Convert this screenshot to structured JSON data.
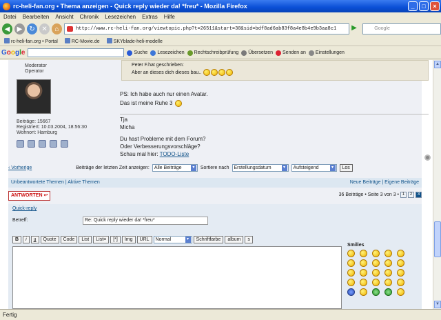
{
  "window": {
    "title": "rc-heli-fan.org • Thema anzeigen - Quick reply wieder da! *freu* - Mozilla Firefox"
  },
  "menu": [
    "Datei",
    "Bearbeiten",
    "Ansicht",
    "Chronik",
    "Lesezeichen",
    "Extras",
    "Hilfe"
  ],
  "nav": {
    "url": "http://www.rc-heli-fan.org/viewtopic.php?t=26511&start=30&sid=bdf8ad6ab83f8a4e8b4e9b3aa8c1",
    "search_placeholder": "Google"
  },
  "bookmarks": [
    "rc-heli-fan.org • Portal",
    "RC-Movie.de",
    "SKYblade-heli-modelle"
  ],
  "google_toolbar": {
    "logo_letters": [
      "G",
      "o",
      "o",
      "g",
      "l",
      "e"
    ],
    "items": [
      "Suche",
      "Lesezeichen",
      "Rechtschreibprüfung",
      "Übersetzen",
      "Senden an",
      "Einstellungen"
    ]
  },
  "post": {
    "rank": [
      "Moderator",
      "Operator"
    ],
    "stats": [
      "Beiträge: 15667",
      "Registriert: 10.03.2004, 18:56:30",
      "Wohnort: Hamburg"
    ],
    "quote_author": "Peter F.hat geschrieben:",
    "quote_text": "Aber an dieses dich dieses bau..",
    "line1": "PS: Ich habe auch nur einen Avatar.",
    "line2": "Das ist meine Ruhe 3 ",
    "greet1": "Tja",
    "greet2": "Micha",
    "sig1": "Du hast Probleme mit dem Forum?",
    "sig2": "Oder Verbesserungsvorschläge?",
    "sig3_prefix": "Schau mal hier: ",
    "sig3_link": "TODO-Liste"
  },
  "sortbar": {
    "back": "‹ Vorherige",
    "label1": "Beiträge der letzten Zeit anzeigen:",
    "sel1": "Alle Beiträge",
    "label2": "Sortiere nach",
    "sel2": "Erstellungsdatum",
    "sel3": "Aufsteigend",
    "go": "Los"
  },
  "linkbar": {
    "left": "Unbeantwortete Themen | Aktive Themen",
    "right": "Neue Beiträge | Eigene Beiträge"
  },
  "pagebar": {
    "answer": "ANTWORTEN",
    "count": "36 Beiträge • Seite 3 von 3 •",
    "pages": [
      "1",
      "2",
      "3"
    ]
  },
  "quickreply": {
    "title": "Quick-reply",
    "subject_label": "Betreff:",
    "subject_value": "Re: Quick reply wieder da! *freu*",
    "buttons": [
      "B",
      "i",
      "u",
      "Quote",
      "Code",
      "List",
      "List=",
      "[*]",
      "Img",
      "URL"
    ],
    "font_size": "Normal",
    "buttons2": [
      "Schriftfarbe",
      "album",
      "s"
    ],
    "smilies_label": "Smilies"
  },
  "status": {
    "text": "Fertig"
  }
}
